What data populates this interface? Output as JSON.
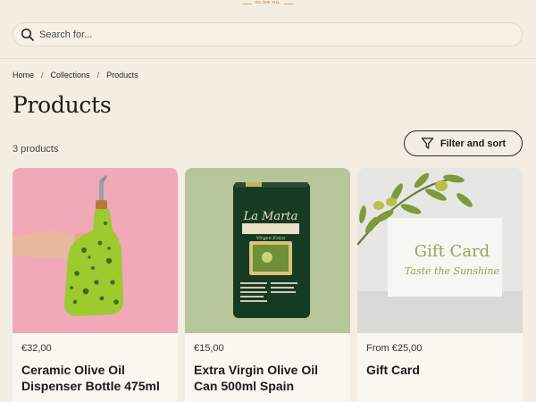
{
  "brand": {
    "tagline": "OLIVE OIL"
  },
  "search": {
    "placeholder": "Search for..."
  },
  "breadcrumb": {
    "items": [
      "Home",
      "Collections",
      "Products"
    ],
    "separator": "/"
  },
  "page": {
    "title": "Products",
    "count": "3 products"
  },
  "filter": {
    "label": "Filter and sort"
  },
  "products": [
    {
      "price": "€32,00",
      "name": "Ceramic Olive Oil Dispenser Bottle 475ml"
    },
    {
      "price": "€15,00",
      "name": "Extra Virgin Olive Oil Can 500ml Spain",
      "can_brand": "La Marta",
      "can_subtitle": "Virgen Extra"
    },
    {
      "price": "From €25,00",
      "name": "Gift Card",
      "card_title": "Gift Card",
      "card_subtitle": "Taste the Sunshine"
    }
  ],
  "colors": {
    "background": "#f4ede1",
    "card_pink": "#f1a8b8",
    "card_green": "#b6c69a",
    "card_grey": "#e6e6e3"
  }
}
